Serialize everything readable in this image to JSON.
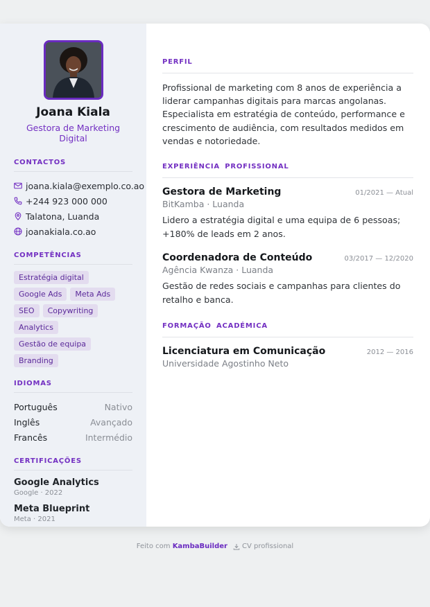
{
  "profile": {
    "name": "Joana Kiala",
    "role": "Gestora de Marketing Digital"
  },
  "contacts": {
    "heading": "CONTACTOS",
    "items": [
      {
        "icon": "mail-icon",
        "value": "joana.kiala@exemplo.co.ao"
      },
      {
        "icon": "phone-icon",
        "value": "+244 923 000 000"
      },
      {
        "icon": "location-icon",
        "value": "Talatona, Luanda"
      },
      {
        "icon": "globe-icon",
        "value": "joanakiala.co.ao"
      }
    ]
  },
  "skills": {
    "heading": "COMPETÊNCIAS",
    "items": [
      "Estratégia digital",
      "Google Ads",
      "Meta Ads",
      "SEO",
      "Copywriting",
      "Analytics",
      "Gestão de equipa",
      "Branding"
    ]
  },
  "languages": {
    "heading": "IDIOMAS",
    "items": [
      {
        "name": "Português",
        "level": "Nativo"
      },
      {
        "name": "Inglês",
        "level": "Avançado"
      },
      {
        "name": "Francês",
        "level": "Intermédio"
      }
    ]
  },
  "certifications": {
    "heading": "CERTIFICAÇÕES",
    "items": [
      {
        "title": "Google Analytics",
        "meta": "Google · 2022"
      },
      {
        "title": "Meta Blueprint",
        "meta": "Meta · 2021"
      }
    ]
  },
  "summary": {
    "heading": "PERFIL",
    "text": "Profissional de marketing com 8 anos de experiência a liderar campanhas digitais para marcas angolanas. Especialista em estratégia de conteúdo, performance e crescimento de audiência, com resultados medidos em vendas e notoriedade."
  },
  "experience": {
    "heading": "EXPERIÊNCIA PROFISSIONAL",
    "items": [
      {
        "title": "Gestora de Marketing",
        "dates": "01/2021 — Atual",
        "org": "BitKamba · Luanda",
        "desc": "Lidero a estratégia digital e uma equipa de 6 pessoas; +180% de leads em 2 anos."
      },
      {
        "title": "Coordenadora de Conteúdo",
        "dates": "03/2017 — 12/2020",
        "org": "Agência Kwanza · Luanda",
        "desc": "Gestão de redes sociais e campanhas para clientes do retalho e banca."
      }
    ]
  },
  "education": {
    "heading": "FORMAÇÃO ACADÉMICA",
    "items": [
      {
        "title": "Licenciatura em Comunicação",
        "dates": "2012 — 2016",
        "org": "Universidade Agostinho Neto"
      }
    ]
  },
  "footer": {
    "made_with": "Feito com",
    "brand": "KambaBuilder",
    "tag": "CV profissional"
  },
  "colors": {
    "accent": "#7330c2",
    "sidebar_bg": "#eef1f6",
    "chip_bg": "#e3dcef"
  }
}
